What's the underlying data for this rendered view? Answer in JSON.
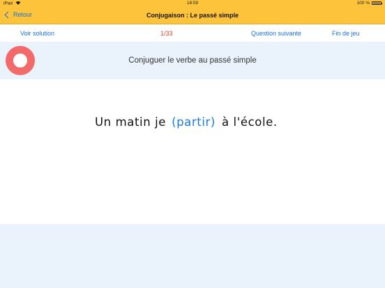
{
  "status_bar": {
    "device": "iPad",
    "wifi_icon": "wifi-icon",
    "time": "18:59",
    "battery_text": "100 %",
    "battery_level": 1.0
  },
  "nav": {
    "back_label": "Retour",
    "title": "Conjugaison : Le passé simple"
  },
  "toolbar": {
    "see_solution": "Voir solution",
    "counter": "1/33",
    "next_question": "Question suivante",
    "end_game": "Fin de jeu"
  },
  "instruction": "Conjuguer le verbe au passé simple",
  "exercise": {
    "prefix": "Un matin je",
    "verb": "(partir)",
    "suffix": "à l'école."
  },
  "colors": {
    "nav_bar": "#fdc33a",
    "link": "#1a6fd6",
    "counter": "#e0432d",
    "ring": "#f26a6a",
    "band": "#eaf3fb"
  }
}
